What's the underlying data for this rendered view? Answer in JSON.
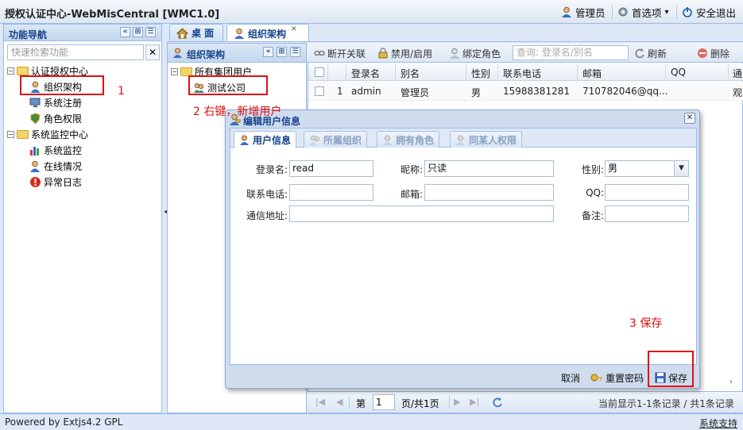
{
  "app": {
    "title": "授权认证中心-WebMisCentral [WMC1.0]"
  },
  "topbar": {
    "user_label": "管理员",
    "prefs_label": "首选项",
    "prefs_caret": "▾",
    "logout_label": "安全退出"
  },
  "nav": {
    "title": "功能导航",
    "search_placeholder": "快速检索功能",
    "groups": [
      {
        "label": "认证授权中心",
        "items": [
          {
            "label": "组织架构",
            "icon": "user-icon"
          },
          {
            "label": "系统注册",
            "icon": "monitor-icon"
          },
          {
            "label": "角色权限",
            "icon": "shield-icon"
          }
        ]
      },
      {
        "label": "系统监控中心",
        "items": [
          {
            "label": "系统监控",
            "icon": "chart-icon"
          },
          {
            "label": "在线情况",
            "icon": "user-online-icon"
          },
          {
            "label": "异常日志",
            "icon": "error-icon"
          }
        ]
      }
    ]
  },
  "tabs": [
    {
      "label": "桌 面",
      "icon": "home-icon"
    },
    {
      "label": "组织架构",
      "icon": "user-icon"
    }
  ],
  "org": {
    "title": "组织架构",
    "root": "所有集团用户",
    "child": "测试公司"
  },
  "grid": {
    "toolbar": {
      "disconnect": "断开关联",
      "toggle": "禁用/启用",
      "bind_role": "绑定角色",
      "search_placeholder": "查询: 登录名/别名",
      "refresh": "刷新",
      "delete": "删除"
    },
    "columns": [
      "登录名",
      "别名",
      "性别",
      "联系电话",
      "邮箱",
      "QQ",
      "通"
    ],
    "rows": [
      {
        "no": "1",
        "login": "admin",
        "alias": "管理员",
        "gender": "男",
        "phone": "15988381281",
        "email": "710782046@qq...",
        "qq": "",
        "extra": "观"
      }
    ]
  },
  "pager": {
    "page_prefix": "第",
    "page_value": "1",
    "page_suffix": "页/共1页",
    "summary": "当前显示1-1条记录 / 共1条记录"
  },
  "footer": {
    "powered": "Powered by Extjs4.2 GPL",
    "support": "系统支持"
  },
  "annotations": {
    "step1": "1",
    "step2": "2  右键，新增用户",
    "step3": "3  保存"
  },
  "dialog": {
    "title": "编辑用户信息",
    "tabs": [
      "用户信息",
      "所属组织",
      "拥有角色",
      "同某人权限"
    ],
    "fields": {
      "login_label": "登录名:",
      "login_value": "read",
      "nick_label": "昵称:",
      "nick_value": "只读",
      "gender_label": "性别:",
      "gender_value": "男",
      "phone_label": "联系电话:",
      "phone_value": "",
      "email_label": "邮箱:",
      "email_value": "",
      "qq_label": "QQ:",
      "qq_value": "",
      "address_label": "通信地址:",
      "address_value": "",
      "remark_label": "备注:",
      "remark_value": ""
    },
    "buttons": {
      "cancel": "取消",
      "reset_pwd": "重置密码",
      "save": "保存"
    }
  },
  "colors": {
    "accent": "#15428b",
    "border": "#99bbe8",
    "annotation": "#e01010"
  }
}
